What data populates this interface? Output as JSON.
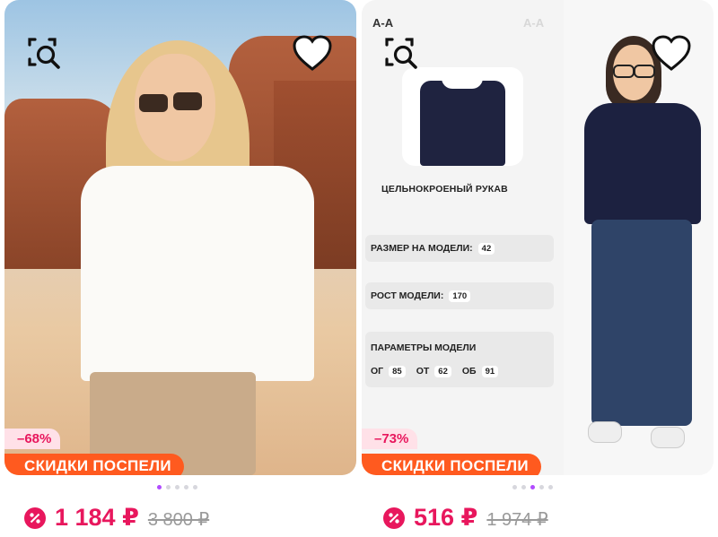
{
  "products": [
    {
      "discount": "–68%",
      "promo": "СКИДКИ ПОСПЕЛИ",
      "price": "1 184 ₽",
      "old_price": "3 800 ₽",
      "dots": {
        "count": 5,
        "active": 0
      }
    },
    {
      "discount": "–73%",
      "promo": "СКИДКИ ПОСПЕЛИ",
      "price": "516 ₽",
      "old_price": "1 974 ₽",
      "dots": {
        "count": 5,
        "active": 2
      },
      "lookbook": {
        "corner_label": "А-А",
        "corner_label_faded": "А-А",
        "sleeve_caption": "ЦЕЛЬНОКРОЕНЫЙ РУКАВ",
        "model_size_label": "РАЗМЕР НА МОДЕЛИ:",
        "model_size_value": "42",
        "model_height_label": "РОСТ МОДЕЛИ:",
        "model_height_value": "170",
        "model_params_label": "ПАРАМЕТРЫ МОДЕЛИ",
        "params": [
          {
            "label": "ОГ",
            "value": "85"
          },
          {
            "label": "ОТ",
            "value": "62"
          },
          {
            "label": "ОБ",
            "value": "91"
          }
        ]
      }
    }
  ],
  "icons": {
    "similar_search": "image-search-icon",
    "favorite": "heart-icon",
    "discount_badge": "percent-badge-icon"
  },
  "colors": {
    "accent_price": "#e8175d",
    "promo_orange": "#ff5a1f",
    "discount_bg": "#ffe1e8",
    "dot_active": "#b14bff"
  }
}
